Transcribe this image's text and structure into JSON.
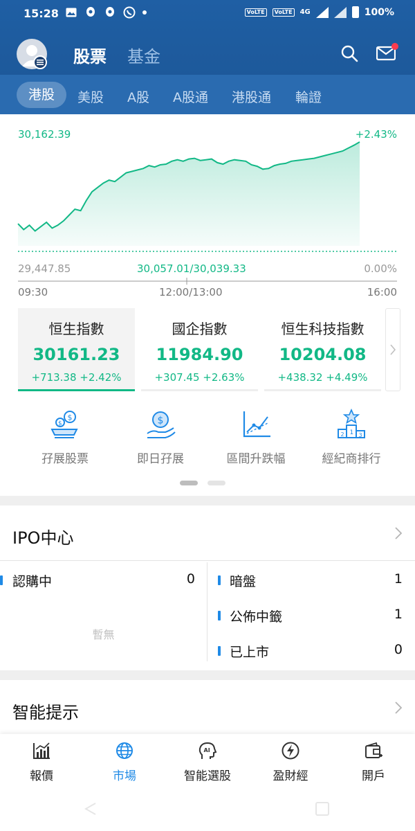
{
  "status_bar": {
    "time": "15:28",
    "battery": "100%",
    "network": "4G"
  },
  "header": {
    "tabs": [
      {
        "label": "股票"
      },
      {
        "label": "基金"
      }
    ],
    "icons": [
      "search-icon",
      "mail-icon"
    ]
  },
  "sub_tabs": [
    {
      "label": "港股"
    },
    {
      "label": "美股"
    },
    {
      "label": "A股"
    },
    {
      "label": "A股通"
    },
    {
      "label": "港股通"
    },
    {
      "label": "輪證"
    }
  ],
  "chart": {
    "high": "30,162.39",
    "low": "29,447.85",
    "change_pct_top": "+2.43%",
    "change_pct_bottom": "0.00%",
    "mid_label": "30,057.01/30,039.33",
    "time_start": "09:30",
    "time_mid": "12:00/13:00",
    "time_end": "16:00",
    "colors": {
      "line": "#12b886",
      "baseline": "#12b886",
      "labels": "#999999"
    }
  },
  "chart_data": {
    "type": "area",
    "title": "",
    "xlabel": "",
    "ylabel": "",
    "ylim": [
      29447.85,
      30162.39
    ],
    "x_ticks": [
      "09:30",
      "12:00/13:00",
      "16:00"
    ],
    "series": [
      {
        "values": [
          29600,
          29560,
          29590,
          29550,
          29580,
          29610,
          29570,
          29590,
          29620,
          29660,
          29700,
          29690,
          29760,
          29820,
          29850,
          29880,
          29900,
          29890,
          29920,
          29950,
          29960,
          29970,
          29980,
          30000,
          29990,
          30005,
          30010,
          30030,
          30040,
          30030,
          30045,
          30050,
          30035,
          30040,
          30045,
          30020,
          30010,
          30030,
          30040,
          30035,
          30030,
          30005,
          29995,
          29975,
          29980,
          30000,
          30010,
          30015,
          30030,
          30035,
          30040,
          30045,
          30050,
          30060,
          30070,
          30080,
          30090,
          30100,
          30120,
          30140,
          30162.39
        ]
      }
    ],
    "baseline": 30039.33
  },
  "indices": [
    {
      "name": "恒生指數",
      "value": "30161.23",
      "change": "+713.38 +2.42%",
      "selected": true
    },
    {
      "name": "國企指數",
      "value": "11984.90",
      "change": "+307.45 +2.63%",
      "selected": false
    },
    {
      "name": "恒生科技指數",
      "value": "10204.08",
      "change": "+438.32 +4.49%",
      "selected": false
    }
  ],
  "quick_actions": [
    {
      "label": "孖展股票",
      "icon": "margin-stocks-icon"
    },
    {
      "label": "即日孖展",
      "icon": "intraday-margin-icon"
    },
    {
      "label": "區間升跌幅",
      "icon": "range-change-icon"
    },
    {
      "label": "經紀商排行",
      "icon": "broker-ranking-icon"
    }
  ],
  "ipo": {
    "title": "IPO中心",
    "left": [
      {
        "label": "認購中",
        "count": "0"
      }
    ],
    "empty_text": "暫無",
    "right": [
      {
        "label": "暗盤",
        "count": "1"
      },
      {
        "label": "公佈中籤",
        "count": "1"
      },
      {
        "label": "已上市",
        "count": "0"
      }
    ]
  },
  "smart_tips": {
    "title": "智能提示"
  },
  "bottom_nav": [
    {
      "label": "報價",
      "icon": "quote-chart-icon",
      "active": false
    },
    {
      "label": "市場",
      "icon": "globe-icon",
      "active": true
    },
    {
      "label": "智能選股",
      "icon": "ai-head-icon",
      "active": false
    },
    {
      "label": "盈財經",
      "icon": "lightning-icon",
      "active": false
    },
    {
      "label": "開戶",
      "icon": "wallet-icon",
      "active": false
    }
  ]
}
